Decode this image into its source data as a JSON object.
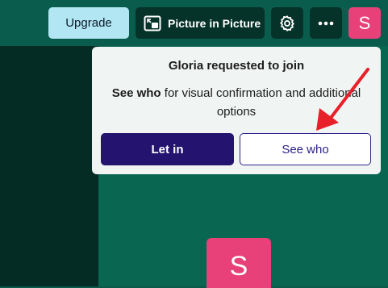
{
  "header": {
    "upgrade_label": "Upgrade",
    "pip_label": "Picture in Picture",
    "avatar_initial": "S"
  },
  "popup": {
    "title": "Gloria requested to join",
    "body_bold": "See who",
    "body_rest": " for visual confirmation and additional options",
    "let_in_label": "Let in",
    "see_who_label": "See who"
  },
  "stage": {
    "participant_initial": "S"
  },
  "colors": {
    "accent_pink": "#e8417a",
    "primary_button": "#241470",
    "annotation_arrow": "#e8202a"
  }
}
